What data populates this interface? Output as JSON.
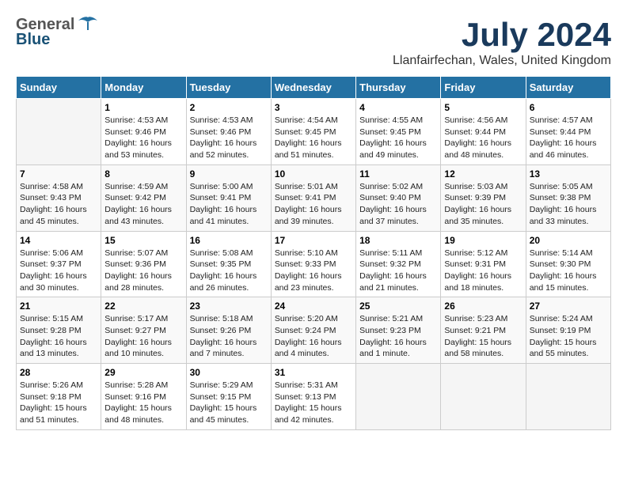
{
  "header": {
    "logo_general": "General",
    "logo_blue": "Blue",
    "month_title": "July 2024",
    "location": "Llanfairfechan, Wales, United Kingdom"
  },
  "calendar": {
    "days_of_week": [
      "Sunday",
      "Monday",
      "Tuesday",
      "Wednesday",
      "Thursday",
      "Friday",
      "Saturday"
    ],
    "weeks": [
      [
        {
          "day": "",
          "info": ""
        },
        {
          "day": "1",
          "info": "Sunrise: 4:53 AM\nSunset: 9:46 PM\nDaylight: 16 hours\nand 53 minutes."
        },
        {
          "day": "2",
          "info": "Sunrise: 4:53 AM\nSunset: 9:46 PM\nDaylight: 16 hours\nand 52 minutes."
        },
        {
          "day": "3",
          "info": "Sunrise: 4:54 AM\nSunset: 9:45 PM\nDaylight: 16 hours\nand 51 minutes."
        },
        {
          "day": "4",
          "info": "Sunrise: 4:55 AM\nSunset: 9:45 PM\nDaylight: 16 hours\nand 49 minutes."
        },
        {
          "day": "5",
          "info": "Sunrise: 4:56 AM\nSunset: 9:44 PM\nDaylight: 16 hours\nand 48 minutes."
        },
        {
          "day": "6",
          "info": "Sunrise: 4:57 AM\nSunset: 9:44 PM\nDaylight: 16 hours\nand 46 minutes."
        }
      ],
      [
        {
          "day": "7",
          "info": "Sunrise: 4:58 AM\nSunset: 9:43 PM\nDaylight: 16 hours\nand 45 minutes."
        },
        {
          "day": "8",
          "info": "Sunrise: 4:59 AM\nSunset: 9:42 PM\nDaylight: 16 hours\nand 43 minutes."
        },
        {
          "day": "9",
          "info": "Sunrise: 5:00 AM\nSunset: 9:41 PM\nDaylight: 16 hours\nand 41 minutes."
        },
        {
          "day": "10",
          "info": "Sunrise: 5:01 AM\nSunset: 9:41 PM\nDaylight: 16 hours\nand 39 minutes."
        },
        {
          "day": "11",
          "info": "Sunrise: 5:02 AM\nSunset: 9:40 PM\nDaylight: 16 hours\nand 37 minutes."
        },
        {
          "day": "12",
          "info": "Sunrise: 5:03 AM\nSunset: 9:39 PM\nDaylight: 16 hours\nand 35 minutes."
        },
        {
          "day": "13",
          "info": "Sunrise: 5:05 AM\nSunset: 9:38 PM\nDaylight: 16 hours\nand 33 minutes."
        }
      ],
      [
        {
          "day": "14",
          "info": "Sunrise: 5:06 AM\nSunset: 9:37 PM\nDaylight: 16 hours\nand 30 minutes."
        },
        {
          "day": "15",
          "info": "Sunrise: 5:07 AM\nSunset: 9:36 PM\nDaylight: 16 hours\nand 28 minutes."
        },
        {
          "day": "16",
          "info": "Sunrise: 5:08 AM\nSunset: 9:35 PM\nDaylight: 16 hours\nand 26 minutes."
        },
        {
          "day": "17",
          "info": "Sunrise: 5:10 AM\nSunset: 9:33 PM\nDaylight: 16 hours\nand 23 minutes."
        },
        {
          "day": "18",
          "info": "Sunrise: 5:11 AM\nSunset: 9:32 PM\nDaylight: 16 hours\nand 21 minutes."
        },
        {
          "day": "19",
          "info": "Sunrise: 5:12 AM\nSunset: 9:31 PM\nDaylight: 16 hours\nand 18 minutes."
        },
        {
          "day": "20",
          "info": "Sunrise: 5:14 AM\nSunset: 9:30 PM\nDaylight: 16 hours\nand 15 minutes."
        }
      ],
      [
        {
          "day": "21",
          "info": "Sunrise: 5:15 AM\nSunset: 9:28 PM\nDaylight: 16 hours\nand 13 minutes."
        },
        {
          "day": "22",
          "info": "Sunrise: 5:17 AM\nSunset: 9:27 PM\nDaylight: 16 hours\nand 10 minutes."
        },
        {
          "day": "23",
          "info": "Sunrise: 5:18 AM\nSunset: 9:26 PM\nDaylight: 16 hours\nand 7 minutes."
        },
        {
          "day": "24",
          "info": "Sunrise: 5:20 AM\nSunset: 9:24 PM\nDaylight: 16 hours\nand 4 minutes."
        },
        {
          "day": "25",
          "info": "Sunrise: 5:21 AM\nSunset: 9:23 PM\nDaylight: 16 hours\nand 1 minute."
        },
        {
          "day": "26",
          "info": "Sunrise: 5:23 AM\nSunset: 9:21 PM\nDaylight: 15 hours\nand 58 minutes."
        },
        {
          "day": "27",
          "info": "Sunrise: 5:24 AM\nSunset: 9:19 PM\nDaylight: 15 hours\nand 55 minutes."
        }
      ],
      [
        {
          "day": "28",
          "info": "Sunrise: 5:26 AM\nSunset: 9:18 PM\nDaylight: 15 hours\nand 51 minutes."
        },
        {
          "day": "29",
          "info": "Sunrise: 5:28 AM\nSunset: 9:16 PM\nDaylight: 15 hours\nand 48 minutes."
        },
        {
          "day": "30",
          "info": "Sunrise: 5:29 AM\nSunset: 9:15 PM\nDaylight: 15 hours\nand 45 minutes."
        },
        {
          "day": "31",
          "info": "Sunrise: 5:31 AM\nSunset: 9:13 PM\nDaylight: 15 hours\nand 42 minutes."
        },
        {
          "day": "",
          "info": ""
        },
        {
          "day": "",
          "info": ""
        },
        {
          "day": "",
          "info": ""
        }
      ]
    ]
  }
}
